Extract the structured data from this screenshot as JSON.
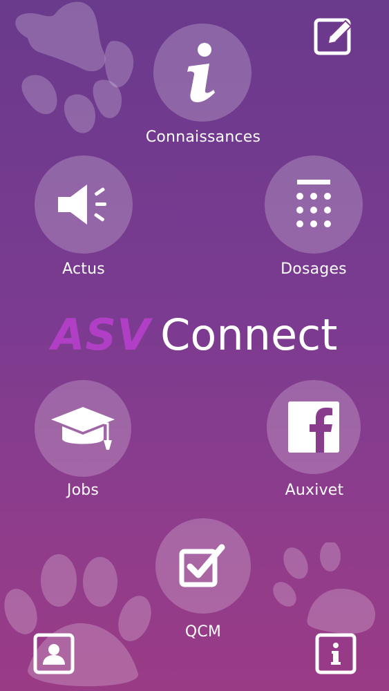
{
  "app": {
    "logo_part1": "ASV",
    "logo_part2": "Connect",
    "logo_color": "#b03fc6"
  },
  "menu": {
    "connaissances": {
      "label": "Connaissances",
      "icon": "info-icon"
    },
    "actus": {
      "label": "Actus",
      "icon": "megaphone-icon"
    },
    "dosages": {
      "label": "Dosages",
      "icon": "calculator-icon"
    },
    "jobs": {
      "label": "Jobs",
      "icon": "graduation-cap-icon"
    },
    "auxivet": {
      "label": "Auxivet",
      "icon": "facebook-icon"
    },
    "qcm": {
      "label": "QCM",
      "icon": "checkbox-icon"
    }
  },
  "corners": {
    "top_right": {
      "icon": "edit-icon"
    },
    "bottom_left": {
      "icon": "profile-icon"
    },
    "bottom_right": {
      "icon": "info-icon"
    }
  },
  "colors": {
    "gradient_top": "#6a3a8c",
    "gradient_bottom": "#9a3b86",
    "circle_fill": "rgba(255,255,255,0.22)",
    "icon": "#ffffff"
  }
}
